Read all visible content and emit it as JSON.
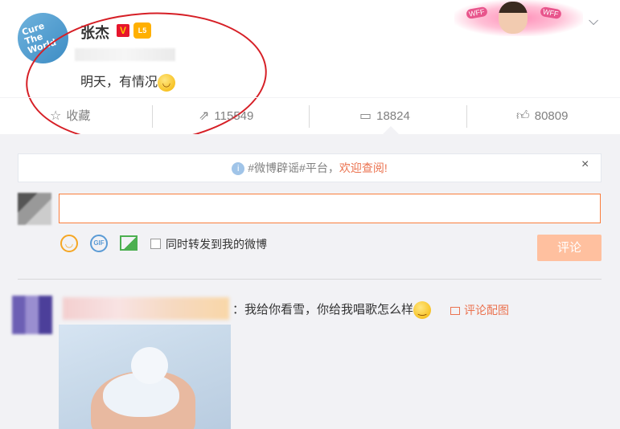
{
  "post": {
    "username": "张杰",
    "verified_badge": "V",
    "level_badge": "L5",
    "text": "明天，有情况",
    "emoji": "smirk-emoji",
    "avatar_text": "Cure The World",
    "banner_tags": [
      "WFF",
      "WFF"
    ]
  },
  "actions": {
    "favorite_label": "收藏",
    "repost_count": "115549",
    "comment_count": "18824",
    "like_count": "80809"
  },
  "notice": {
    "prefix": "#微博辟谣#平台，",
    "link": "欢迎查阅!",
    "close": "×"
  },
  "compose": {
    "input_value": "",
    "forward_label": "同时转发到我的微博",
    "submit_label": "评论",
    "gif_label": "GIF"
  },
  "comments": [
    {
      "text": "：我给你看雪，你给我唱歌怎么样",
      "photo_link": "评论配图"
    }
  ],
  "colors": {
    "accent_orange": "#eb7350",
    "input_border": "#fa7d3c",
    "submit_disabled": "#ffc09f",
    "annotation_red": "#d61f26",
    "page_gray": "#f2f2f5"
  }
}
